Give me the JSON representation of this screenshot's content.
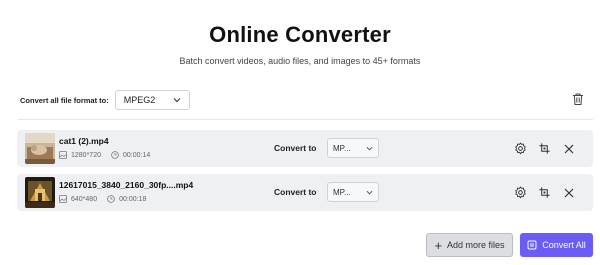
{
  "header": {
    "title": "Online Converter",
    "subtitle": "Batch convert videos, audio files, and images to 45+ formats"
  },
  "format_bar": {
    "label": "Convert all file format to:",
    "selected": "MPEG2"
  },
  "files": [
    {
      "name": "cat1 (2).mp4",
      "resolution": "1280*720",
      "duration": "00:00:14",
      "convert_label": "Convert to",
      "format": "MP..."
    },
    {
      "name": "12617015_3840_2160_30fp....mp4",
      "resolution": "640*480",
      "duration": "00:00:18",
      "convert_label": "Convert to",
      "format": "MP..."
    }
  ],
  "footer": {
    "add_more_label": "Add more files",
    "convert_all_label": "Convert All"
  },
  "colors": {
    "accent": "#6a5cf4",
    "row_bg": "#eef0f4"
  },
  "icons": [
    "chevron-down-icon",
    "trash-icon",
    "resolution-icon",
    "clock-icon",
    "settings-icon",
    "edit-icon",
    "close-icon",
    "plus-icon",
    "convert-icon"
  ]
}
